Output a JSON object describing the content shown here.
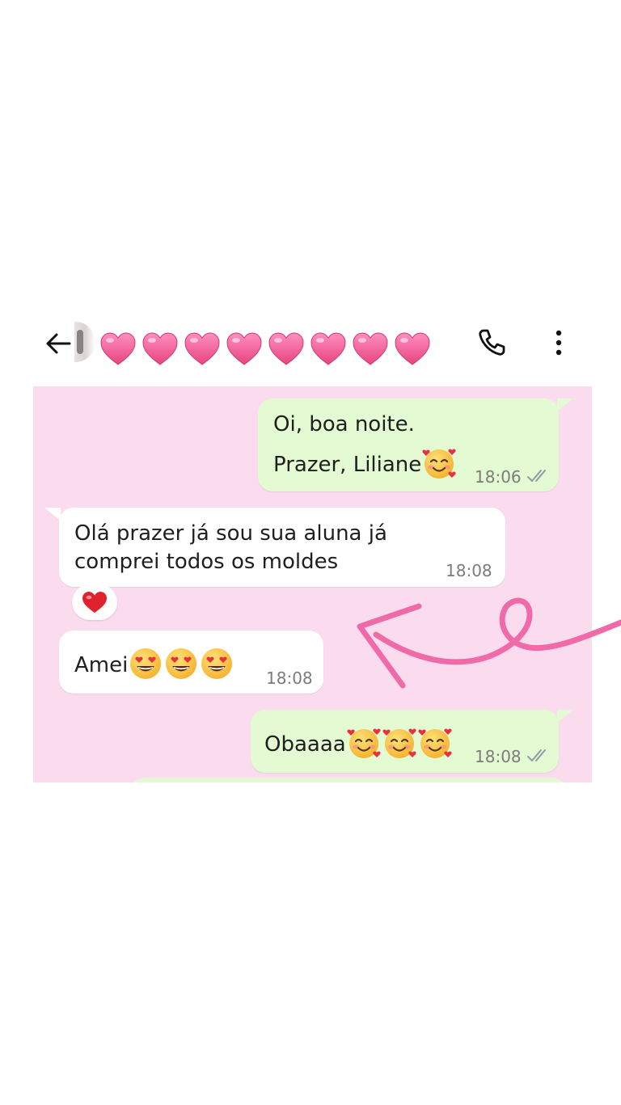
{
  "header": {
    "contact_name_emoji": "💗💗💗💗💗💗💗💗",
    "back_icon": "arrow-left-icon",
    "call_icon": "phone-icon",
    "menu_icon": "more-vertical-icon"
  },
  "messages": [
    {
      "direction": "outgoing",
      "lines": [
        "Oi, boa noite.",
        "Prazer, Liliane🥰"
      ],
      "time": "18:06",
      "status": "read"
    },
    {
      "direction": "incoming",
      "lines": [
        "Olá prazer já sou sua aluna  já",
        "comprei todos os  moldes"
      ],
      "time": "18:08",
      "reaction": "❤️"
    },
    {
      "direction": "incoming",
      "lines": [
        "Amei😍😍😍"
      ],
      "time": "18:08"
    },
    {
      "direction": "outgoing",
      "lines": [
        "Obaaaa🥰🥰🥰"
      ],
      "time": "18:08",
      "status": "read"
    }
  ],
  "colors": {
    "chat_background": "#fbdcef",
    "outgoing_bubble": "#e3fad2",
    "incoming_bubble": "#ffffff",
    "heart": "#f25c9a",
    "doodle_arrow": "#f06aa9",
    "read_ticks": "#8e9aa6"
  }
}
